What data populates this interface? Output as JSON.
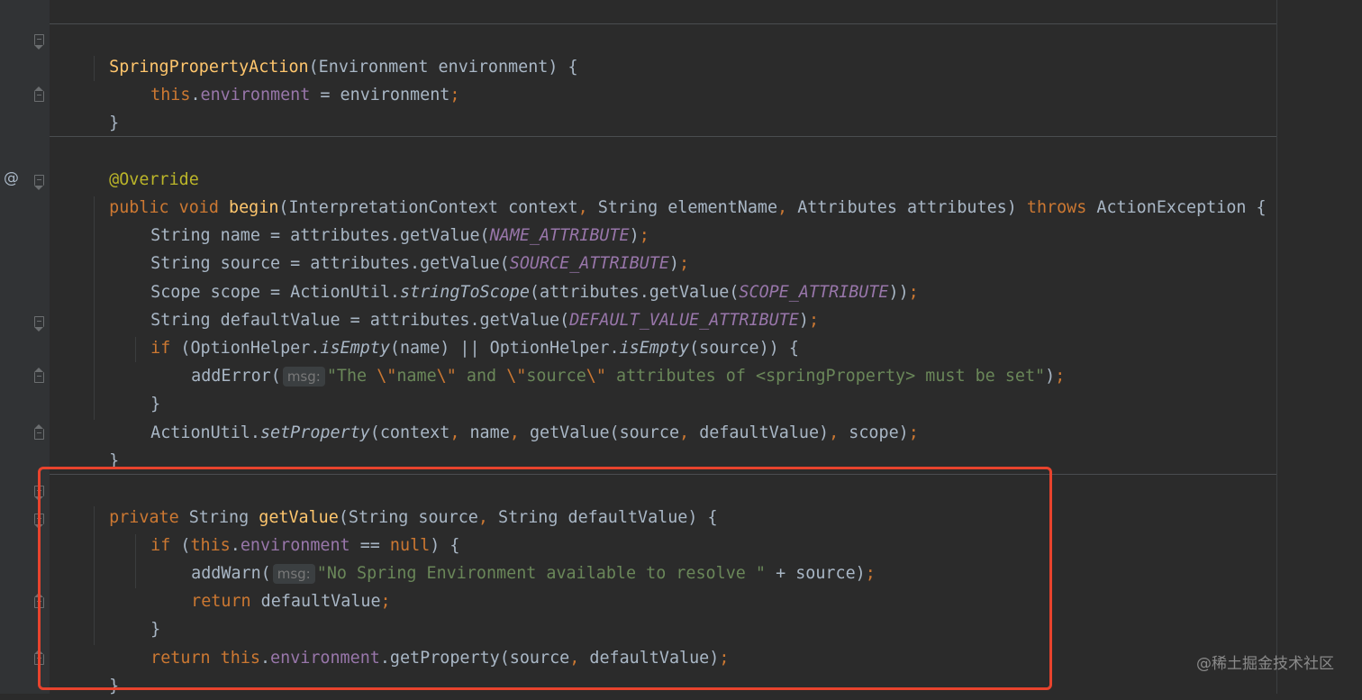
{
  "editor": {
    "watermark": "@稀土掘金技术社区",
    "override_marker": "@",
    "lines": {
      "l1": {
        "t1": "SpringPropertyAction",
        "t2": "(Environment environment) {"
      },
      "l2": {
        "t1": "this",
        "t2": ".",
        "t3": "environment",
        "t4": " = environment",
        "t5": ";"
      },
      "l3": {
        "t1": "}"
      },
      "l4": {
        "t1": "@Override"
      },
      "l5": {
        "t1": "public void ",
        "t2": "begin",
        "t3": "(InterpretationContext context",
        "t4": ", ",
        "t5": "String elementName",
        "t6": ", ",
        "t7": "Attributes attributes) ",
        "t8": "throws ",
        "t9": "ActionException {"
      },
      "l6": {
        "t1": "String name = attributes.getValue(",
        "t2": "NAME_ATTRIBUTE",
        "t3": ")",
        "t4": ";"
      },
      "l7": {
        "t1": "String source = attributes.getValue(",
        "t2": "SOURCE_ATTRIBUTE",
        "t3": ")",
        "t4": ";"
      },
      "l8": {
        "t1": "Scope scope = ActionUtil.",
        "t2": "stringToScope",
        "t3": "(attributes.getValue(",
        "t4": "SCOPE_ATTRIBUTE",
        "t5": "))",
        "t6": ";"
      },
      "l9": {
        "t1": "String defaultValue = attributes.getValue(",
        "t2": "DEFAULT_VALUE_ATTRIBUTE",
        "t3": ")",
        "t4": ";"
      },
      "l10": {
        "t1": "if ",
        "t2": "(OptionHelper.",
        "t3": "isEmpty",
        "t4": "(name) || OptionHelper.",
        "t5": "isEmpty",
        "t6": "(source)) {"
      },
      "l11": {
        "t1": "addError(",
        "hint": "msg:",
        "t2": "\"The ",
        "t3": "\\\"",
        "t4": "name",
        "t5": "\\\"",
        "t6": " and ",
        "t7": "\\\"",
        "t8": "source",
        "t9": "\\\"",
        "t10": " attributes of <springProperty> must be set\"",
        "t11": ")",
        "t12": ";"
      },
      "l12": {
        "t1": "}"
      },
      "l13": {
        "t1": "ActionUtil.",
        "t2": "setProperty",
        "t3": "(context",
        "t4": ", ",
        "t5": "name",
        "t6": ", ",
        "t7": "getValue(source",
        "t8": ", ",
        "t9": "defaultValue)",
        "t10": ", ",
        "t11": "scope)",
        "t12": ";"
      },
      "l14": {
        "t1": "}"
      },
      "l15": {
        "t1": "private ",
        "t2": "String ",
        "t3": "getValue",
        "t4": "(String source",
        "t5": ", ",
        "t6": "String defaultValue) {"
      },
      "l16": {
        "t1": "if ",
        "t2": "(",
        "t3": "this",
        "t4": ".",
        "t5": "environment",
        "t6": " == ",
        "t7": "null",
        "t8": ") {"
      },
      "l17": {
        "t1": "addWarn(",
        "hint": "msg:",
        "t2": "\"No Spring Environment available to resolve \"",
        "t3": " + source)",
        "t4": ";"
      },
      "l18": {
        "t1": "return ",
        "t2": "defaultValue",
        "t3": ";"
      },
      "l19": {
        "t1": "}"
      },
      "l20": {
        "t1": "return ",
        "t2": "this",
        "t3": ".",
        "t4": "environment",
        "t5": ".getProperty(source",
        "t6": ", ",
        "t7": "defaultValue)",
        "t8": ";"
      },
      "l21": {
        "t1": "}"
      }
    }
  }
}
